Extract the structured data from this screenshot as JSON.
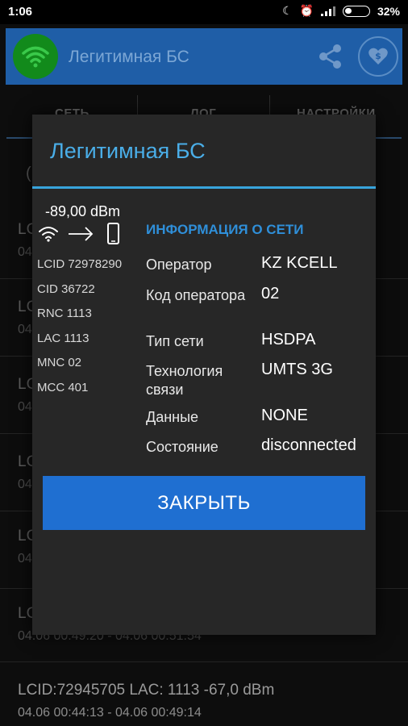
{
  "status_bar": {
    "time": "1:06",
    "battery": "32%"
  },
  "app_bar": {
    "title": "Легитимная БС",
    "logo_icon": "wifi-icon",
    "share_icon": "share-icon",
    "donate_icon": "heart-dollar-icon"
  },
  "tabs": [
    {
      "label": "СЕТЬ"
    },
    {
      "label": "ЛОГ"
    },
    {
      "label": "НАСТРОЙКИ"
    }
  ],
  "list": {
    "item1": {
      "line1": "LCID",
      "line2": "04"
    },
    "item2": {
      "line1": "LCI",
      "line2": "04"
    },
    "item3": {
      "line1": "LCI",
      "line2": "04"
    },
    "item4": {
      "line1": "LCI",
      "line2": "04"
    },
    "item5": {
      "line1": "LCI",
      "line2": "04"
    },
    "item6": {
      "line1": "LCI",
      "line2": "04.06 00:49:20 - 04.06 00:51:54"
    },
    "item7": {
      "line1": "LCID:72945705  LAC: 1113  -67,0 dBm",
      "line2": "04.06 00:44:13 - 04.06 00:49:14"
    }
  },
  "dialog": {
    "title": "Легитимная БС",
    "signal": "-89,00 dBm",
    "cell_ids": [
      "LCID 72978290",
      "CID 36722",
      "RNC 1113",
      "LAC 1113",
      "MNC 02",
      "MCC 401"
    ],
    "network_header": "ИНФОРМАЦИЯ О СЕТИ",
    "info": {
      "operator": {
        "label": "Оператор",
        "value": "KZ KCELL"
      },
      "operator_code": {
        "label": "Код оператора",
        "value": "02"
      },
      "network_type": {
        "label": "Тип сети",
        "value": "HSDPA"
      },
      "technology": {
        "label": "Технология связи",
        "value": "UMTS 3G"
      },
      "data": {
        "label": "Данные",
        "value": "NONE"
      },
      "state": {
        "label": "Состояние",
        "value": "disconnected"
      }
    },
    "close_label": "ЗАКРЫТЬ"
  },
  "colors": {
    "app_bar": "#1f5ea7",
    "accent": "#38a4dc",
    "button": "#1f6fd1",
    "logo": "#128a1b"
  }
}
